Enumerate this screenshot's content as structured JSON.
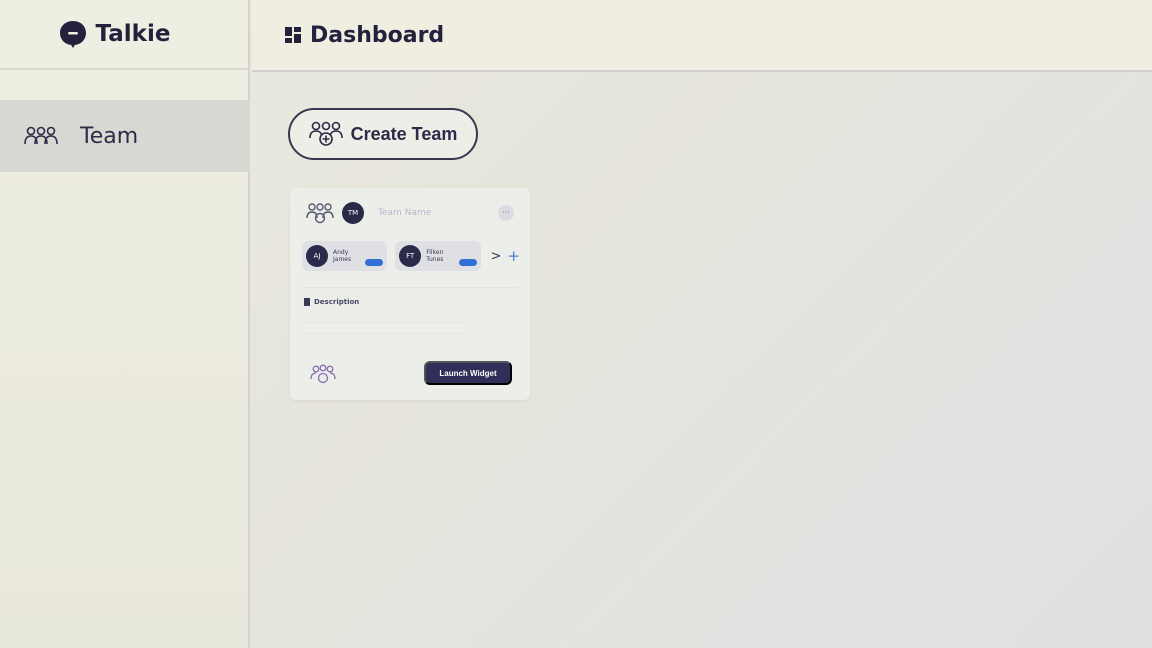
{
  "brand": {
    "name": "Talkie"
  },
  "sidebar": {
    "items": [
      {
        "label": "Team",
        "icon": "users-icon"
      }
    ]
  },
  "header": {
    "title": "Dashboard",
    "icon": "dashboard-icon"
  },
  "main": {
    "create_button_label": "Create Team",
    "card": {
      "avatar_initials": "TM",
      "team_name_placeholder": "Team Name",
      "more_label": "···",
      "members": [
        {
          "initials": "AJ",
          "name": "Andy James"
        },
        {
          "initials": "FT",
          "name": "Filken Tunes"
        }
      ],
      "chevron": ">",
      "add_label": "+",
      "description_label": "Description",
      "launch_button_label": "Launch Widget"
    }
  },
  "colors": {
    "primary_dark": "#302f5a",
    "accent_blue": "#2f6fd6",
    "sidebar_active": "#d9d9d3"
  }
}
